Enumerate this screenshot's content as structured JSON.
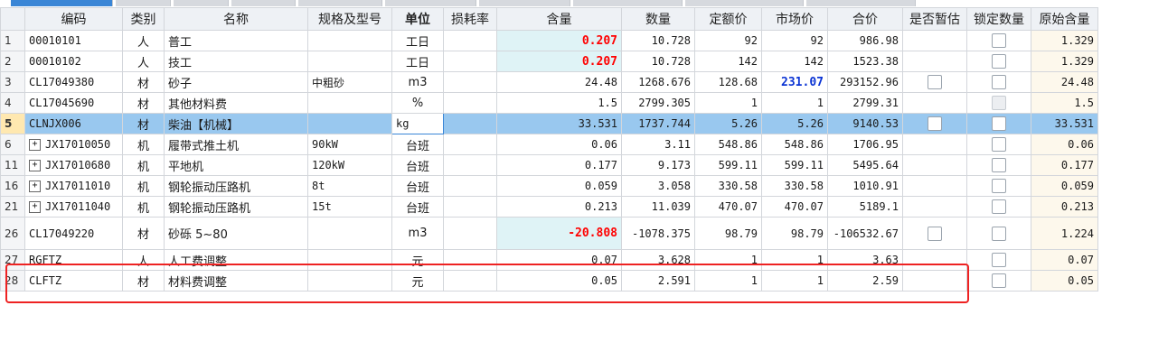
{
  "tabs": [
    {
      "label": ""
    },
    {
      "label": ""
    },
    {
      "label": ""
    },
    {
      "label": ""
    },
    {
      "label": ""
    },
    {
      "label": ""
    },
    {
      "label": ""
    },
    {
      "label": ""
    },
    {
      "label": ""
    },
    {
      "label": ""
    }
  ],
  "columns": {
    "code": "编码",
    "category": "类别",
    "name": "名称",
    "spec": "规格及型号",
    "unit": "单位",
    "loss": "损耗率",
    "content": "含量",
    "qty": "数量",
    "quota_price": "定额价",
    "market_price": "市场价",
    "total": "合价",
    "provisional": "是否暂估",
    "lock_qty": "锁定数量",
    "orig_content": "原始含量"
  },
  "rows": [
    {
      "no": "1",
      "code": "00010101",
      "expand": "",
      "cat": "人",
      "name": "普工",
      "spec": "",
      "unit": "工日",
      "loss": "",
      "content": "0.207",
      "qty": "10.728",
      "quota": "92",
      "market": "92",
      "total": "986.98",
      "orig": "1.329"
    },
    {
      "no": "2",
      "code": "00010102",
      "expand": "",
      "cat": "人",
      "name": "技工",
      "spec": "",
      "unit": "工日",
      "loss": "",
      "content": "0.207",
      "qty": "10.728",
      "quota": "142",
      "market": "142",
      "total": "1523.38",
      "orig": "1.329"
    },
    {
      "no": "3",
      "code": "CL17049380",
      "expand": "",
      "cat": "材",
      "name": "砂子",
      "spec": "中粗砂",
      "unit": "m3",
      "loss": "",
      "content": "24.48",
      "qty": "1268.676",
      "quota": "128.68",
      "market": "231.07",
      "total": "293152.96",
      "orig": "24.48"
    },
    {
      "no": "4",
      "code": "CL17045690",
      "expand": "",
      "cat": "材",
      "name": "其他材料费",
      "spec": "",
      "unit": "%",
      "loss": "",
      "content": "1.5",
      "qty": "2799.305",
      "quota": "1",
      "market": "1",
      "total": "2799.31",
      "orig": "1.5"
    },
    {
      "no": "5",
      "code": "CLNJX006",
      "expand": "",
      "cat": "材",
      "name": "柴油【机械】",
      "spec": "",
      "unit": "kg",
      "loss": "",
      "content": "33.531",
      "qty": "1737.744",
      "quota": "5.26",
      "market": "5.26",
      "total": "9140.53",
      "orig": "33.531"
    },
    {
      "no": "6",
      "code": "JX17010050",
      "expand": "+",
      "cat": "机",
      "name": "履带式推土机",
      "spec": "90kW",
      "unit": "台班",
      "loss": "",
      "content": "0.06",
      "qty": "3.11",
      "quota": "548.86",
      "market": "548.86",
      "total": "1706.95",
      "orig": "0.06"
    },
    {
      "no": "11",
      "code": "JX17010680",
      "expand": "+",
      "cat": "机",
      "name": "平地机",
      "spec": "120kW",
      "unit": "台班",
      "loss": "",
      "content": "0.177",
      "qty": "9.173",
      "quota": "599.11",
      "market": "599.11",
      "total": "5495.64",
      "orig": "0.177"
    },
    {
      "no": "16",
      "code": "JX17011010",
      "expand": "+",
      "cat": "机",
      "name": "钢轮振动压路机",
      "spec": "8t",
      "unit": "台班",
      "loss": "",
      "content": "0.059",
      "qty": "3.058",
      "quota": "330.58",
      "market": "330.58",
      "total": "1010.91",
      "orig": "0.059"
    },
    {
      "no": "21",
      "code": "JX17011040",
      "expand": "+",
      "cat": "机",
      "name": "钢轮振动压路机",
      "spec": "15t",
      "unit": "台班",
      "loss": "",
      "content": "0.213",
      "qty": "11.039",
      "quota": "470.07",
      "market": "470.07",
      "total": "5189.1",
      "orig": "0.213"
    },
    {
      "no": "26",
      "code": "CL17049220",
      "expand": "",
      "cat": "材",
      "name": "砂砾 5~80",
      "spec": "",
      "unit": "m3",
      "loss": "",
      "content": "-20.808",
      "qty": "-1078.375",
      "quota": "98.79",
      "market": "98.79",
      "total": "-106532.67",
      "orig": "1.224"
    },
    {
      "no": "27",
      "code": "RGFTZ",
      "expand": "",
      "cat": "人",
      "name": "人工费调整",
      "spec": "",
      "unit": "元",
      "loss": "",
      "content": "0.07",
      "qty": "3.628",
      "quota": "1",
      "market": "1",
      "total": "3.63",
      "orig": "0.07"
    },
    {
      "no": "28",
      "code": "CLFTZ",
      "expand": "",
      "cat": "材",
      "name": "材料费调整",
      "spec": "",
      "unit": "元",
      "loss": "",
      "content": "0.05",
      "qty": "2.591",
      "quota": "1",
      "market": "1",
      "total": "2.59",
      "orig": "0.05"
    }
  ],
  "colors": {
    "selected_row": "#99c8ef",
    "highlight_content": "#dff3f6",
    "red_value": "#ff0000",
    "blue_value": "#0b34d4",
    "annotation_box": "#ee2222"
  }
}
